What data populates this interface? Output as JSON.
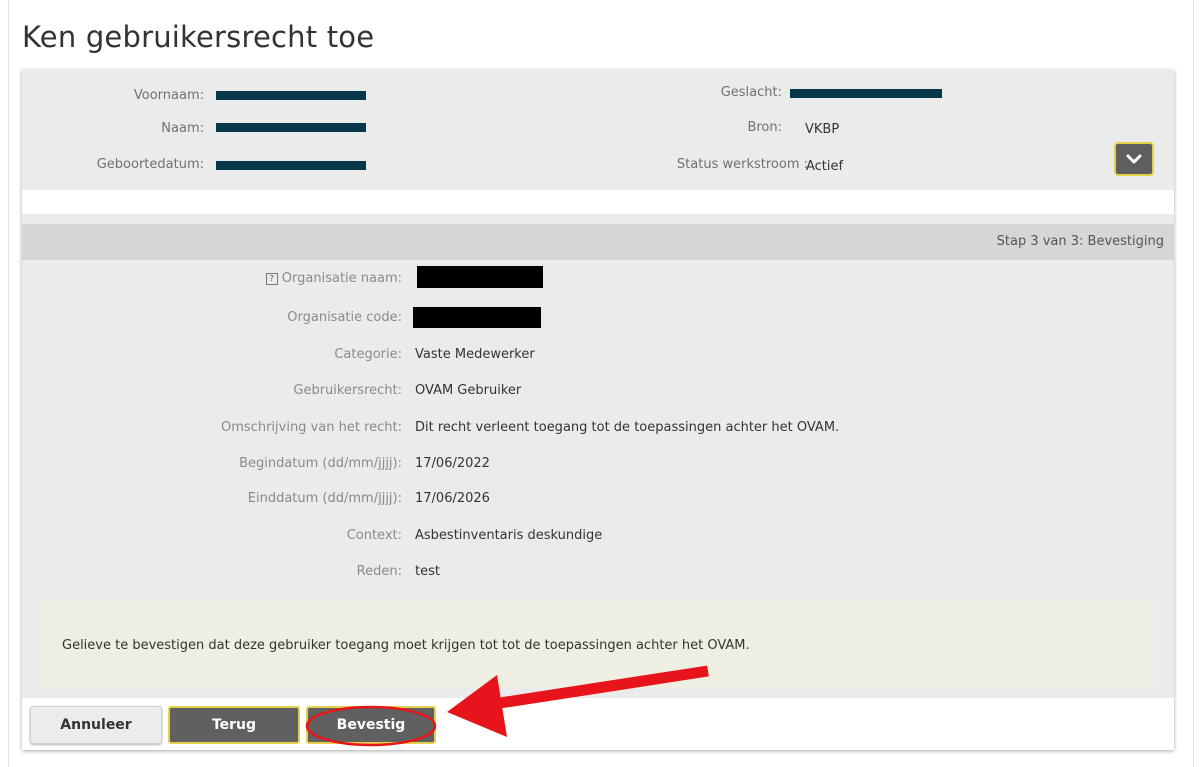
{
  "page": {
    "title": "Ken gebruikersrecht toe"
  },
  "person": {
    "first_name_label": "Voornaam:",
    "last_name_label": "Naam:",
    "birthdate_label": "Geboortedatum:",
    "gender_label": "Geslacht:",
    "source_label": "Bron:",
    "source_value": "VKBP",
    "workflow_status_label": "Status werkstroom :",
    "workflow_status_value": "Actief"
  },
  "step": {
    "text": "Stap 3 van 3: Bevestiging"
  },
  "details": {
    "org_name_label": "Organisatie naam:",
    "org_code_label": "Organisatie code:",
    "category_label": "Categorie:",
    "category_value": "Vaste Medewerker",
    "right_label": "Gebruikersrecht:",
    "right_value": "OVAM Gebruiker",
    "description_label": "Omschrijving van het recht:",
    "description_value": "Dit recht verleent toegang tot de toepassingen achter het OVAM.",
    "start_date_label": "Begindatum (dd/mm/jjjj):",
    "start_date_value": "17/06/2022",
    "end_date_label": "Einddatum (dd/mm/jjjj):",
    "end_date_value": "17/06/2026",
    "context_label": "Context:",
    "context_value": "Asbestinventaris deskundige",
    "reason_label": "Reden:",
    "reason_value": "test",
    "help_glyph": "?"
  },
  "notice": {
    "text": "Gelieve te bevestigen dat deze gebruiker toegang moet krijgen tot tot de toepassingen achter het OVAM."
  },
  "actions": {
    "cancel_label": "Annuleer",
    "back_label": "Terug",
    "confirm_label": "Bevestig"
  },
  "colors": {
    "accent_border": "#e6cf4a",
    "button_dark": "#606060",
    "annotation_red": "#e8141c",
    "redaction_navy": "#07384a"
  },
  "icons": {
    "expand": "chevron-down-icon",
    "help": "help-icon"
  }
}
